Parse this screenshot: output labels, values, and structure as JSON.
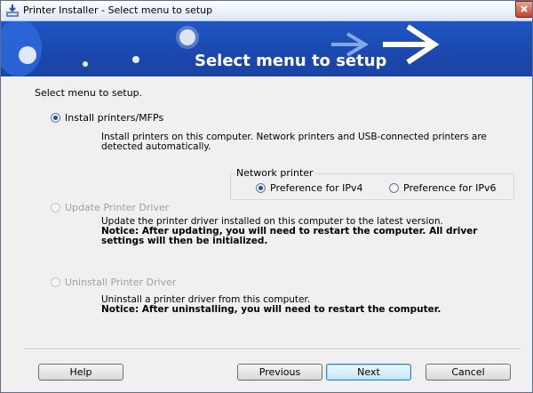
{
  "window": {
    "title": "Printer Installer - Select menu to setup",
    "close_icon": "close-icon",
    "app_icon": "installer-icon"
  },
  "banner": {
    "title": "Select menu to setup",
    "colors": {
      "background": "#1b48ad",
      "title": "#ffffff"
    }
  },
  "main": {
    "prompt": "Select menu to setup.",
    "options": [
      {
        "label": "Install printers/MFPs",
        "selected": true,
        "enabled": true,
        "description": "Install printers on this computer. Network printers and USB-connected printers are",
        "description2": "detected automatically."
      },
      {
        "label": "Update Printer Driver",
        "selected": false,
        "enabled": false,
        "description": "Update the printer driver installed on this computer to the latest version.",
        "notice": "Notice: After updating, you will need to restart the computer. All driver",
        "notice2": "settings will then be initialized."
      },
      {
        "label": "Uninstall Printer Driver",
        "selected": false,
        "enabled": false,
        "description": "Uninstall a printer driver from this computer.",
        "notice": "Notice: After uninstalling, you will need to restart the computer."
      }
    ],
    "network_printer": {
      "legend": "Network printer",
      "options": [
        {
          "label": "Preference for IPv4",
          "selected": true
        },
        {
          "label": "Preference for IPv6",
          "selected": false
        }
      ]
    }
  },
  "footer": {
    "help_label": "Help",
    "previous_label": "Previous",
    "next_label": "Next",
    "cancel_label": "Cancel"
  }
}
